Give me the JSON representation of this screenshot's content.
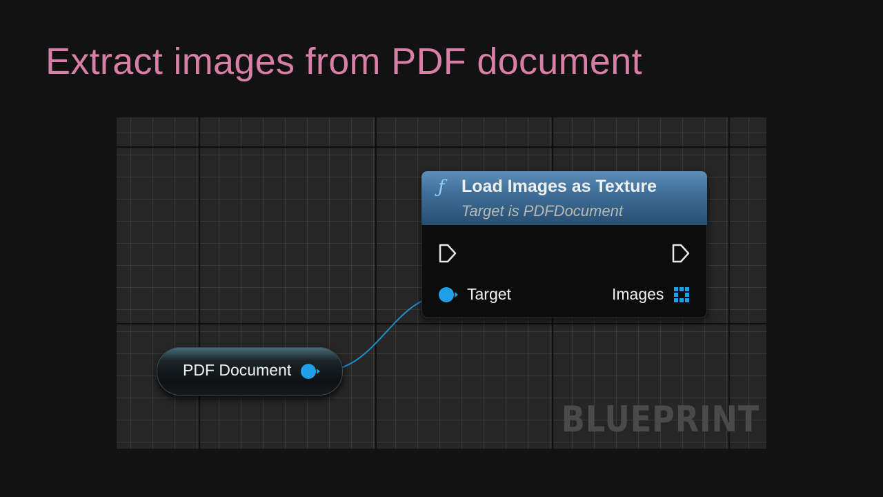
{
  "slide": {
    "title": "Extract images from PDF document"
  },
  "graph": {
    "watermark": "BLUEPRINT"
  },
  "function_node": {
    "icon": "function-icon",
    "title": "Load Images as Texture",
    "subtitle": "Target is PDFDocument",
    "input_pin_label": "Target",
    "output_pin_label": "Images"
  },
  "variable_node": {
    "label": "PDF Document"
  },
  "colors": {
    "title": "#d77fa6",
    "pin": "#1fa0e8",
    "header": "#3f6f98"
  }
}
